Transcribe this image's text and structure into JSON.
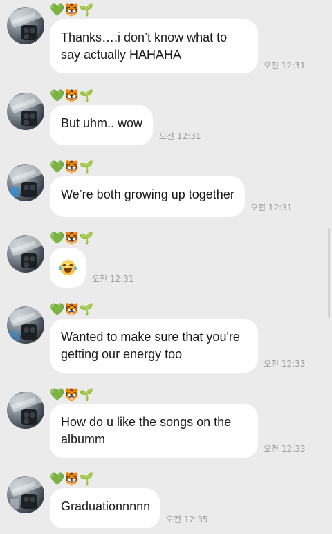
{
  "sender": {
    "heart": "💚",
    "tiger": "🐯",
    "sprout": "🌱"
  },
  "messages": [
    {
      "text": "Thanks….i don’t know what to say actually HAHAHA",
      "time": "오전 12:31"
    },
    {
      "text": "But uhm.. wow",
      "time": "오전 12:31"
    },
    {
      "text": "We’re both growing up together",
      "time": "오전 12:31"
    },
    {
      "text": "",
      "emoji": "grinning-squinting-face",
      "time": "오전 12:31"
    },
    {
      "text": "Wanted to make sure that you're getting our energy too",
      "time": "오전 12:33"
    },
    {
      "text": "How do u like the songs on the albumm",
      "time": "오전 12:33"
    },
    {
      "text": "Graduationnnnn",
      "time": "오전 12:35"
    }
  ],
  "colors": {
    "background": "#ebebeb",
    "bubble": "#ffffff",
    "time": "#9a9a9a"
  }
}
